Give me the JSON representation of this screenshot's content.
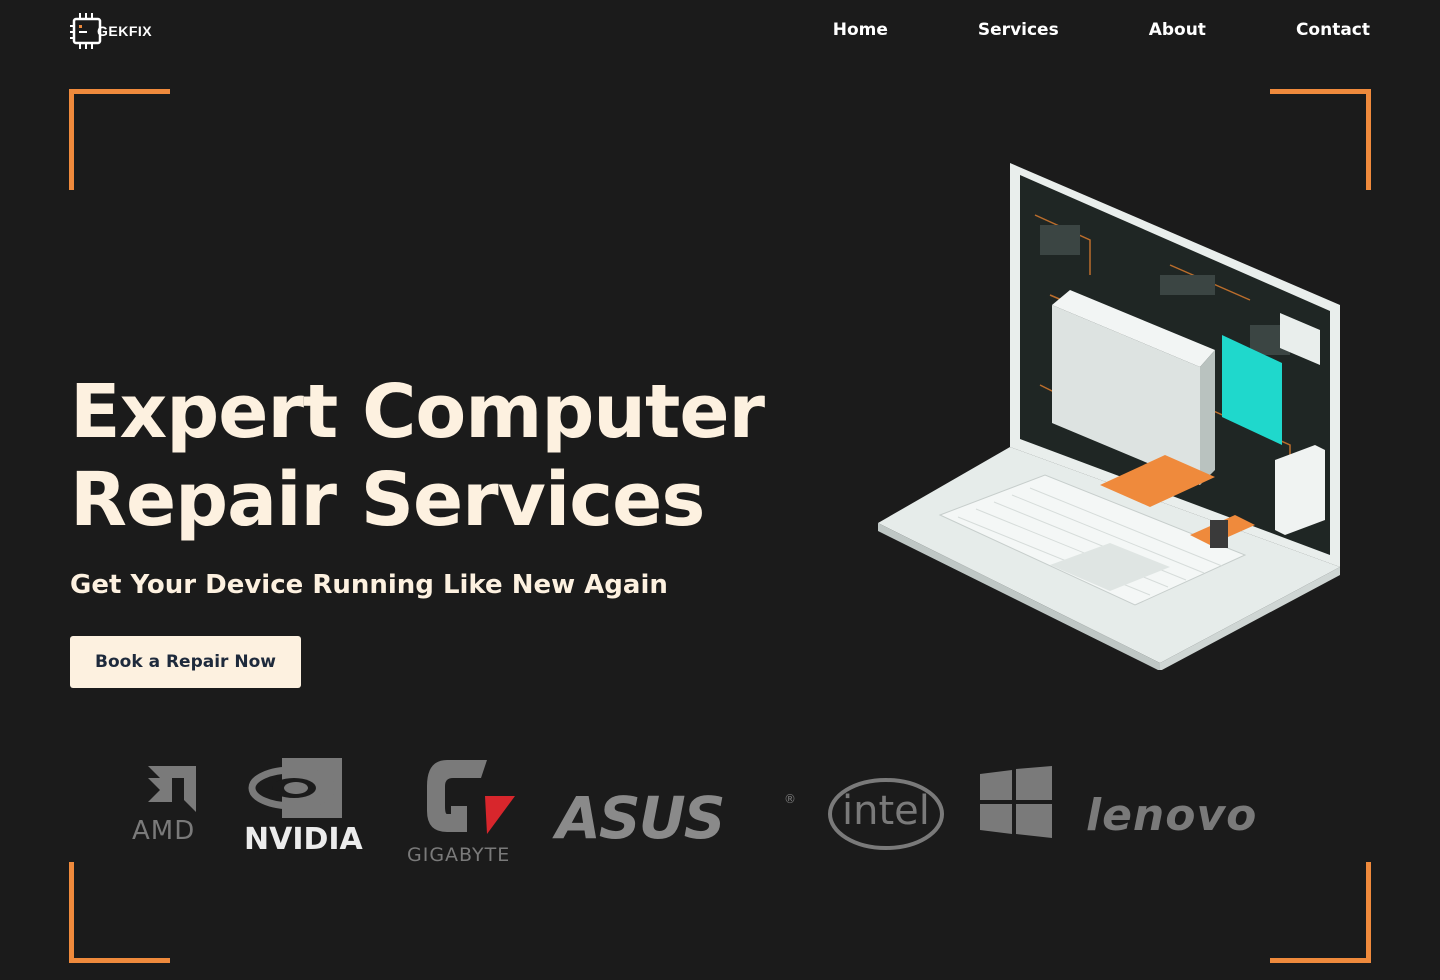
{
  "brand": {
    "name_prefix": "G",
    "name_accent": "",
    "name_rest": "EKFIX",
    "logo_icon": "chip-icon",
    "accent_color": "#ef8a3c"
  },
  "nav": {
    "items": [
      {
        "label": "Home"
      },
      {
        "label": "Services"
      },
      {
        "label": "About"
      },
      {
        "label": "Contact"
      }
    ]
  },
  "hero": {
    "title_line1": "Expert Computer",
    "title_line2": "Repair Services",
    "subtitle": "Get Your Device Running Like New Again",
    "cta_label": "Book a Repair Now",
    "illustration_icon": "open-laptop-illustration"
  },
  "partners": {
    "logos": [
      {
        "name": "AMD",
        "icon": "amd-logo"
      },
      {
        "name": "NVIDIA",
        "icon": "nvidia-logo"
      },
      {
        "name": "GIGABYTE",
        "icon": "gigabyte-logo"
      },
      {
        "name": "ASUS",
        "icon": "asus-logo"
      },
      {
        "name": "intel",
        "icon": "intel-logo"
      },
      {
        "name": "",
        "icon": "windows-logo"
      },
      {
        "name": "lenovo",
        "icon": "lenovo-logo"
      }
    ]
  },
  "colors": {
    "background": "#1b1b1b",
    "cream": "#fdf1e0",
    "accent": "#ef8a3c",
    "logo_grey": "#7a7a7a"
  }
}
